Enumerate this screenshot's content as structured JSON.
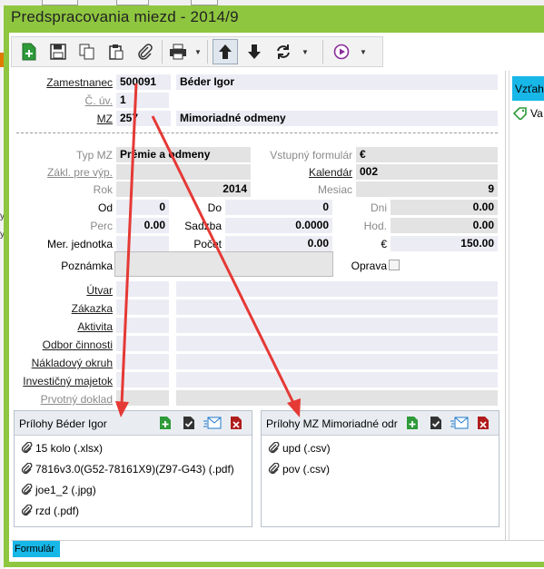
{
  "window": {
    "title": "Predspracovania miezd - 2014/9"
  },
  "background": {
    "left_fragments": [
      "y",
      "y"
    ]
  },
  "toolbar": {
    "icons": [
      "new-icon",
      "save-icon",
      "copy-icon",
      "paste-icon",
      "attach-icon",
      "print-icon",
      "arrow-up-icon",
      "arrow-down-icon",
      "refresh-icon",
      "play-icon"
    ]
  },
  "form": {
    "zamestnanec": {
      "label": "Zamestnanec",
      "code": "500091",
      "name": "Béder Igor"
    },
    "cuv": {
      "label": "Č. úv.",
      "value": "1"
    },
    "mz": {
      "label": "MZ",
      "code": "257",
      "name": "Mimoriadné odmeny"
    },
    "typ_mz": {
      "label": "Typ MZ",
      "value": "Prémie a odmeny"
    },
    "zakl_pre_vyp": {
      "label": "Zákl. pre výp.",
      "value": ""
    },
    "rok": {
      "label": "Rok",
      "value": "2014"
    },
    "od": {
      "label": "Od",
      "value": "0"
    },
    "perc": {
      "label": "Perc",
      "value": "0.00"
    },
    "mer_jednotka": {
      "label": "Mer. jednotka",
      "value": ""
    },
    "vstupny_formular": {
      "label": "Vstupný formulár",
      "value": "€"
    },
    "kalendar": {
      "label": "Kalendár",
      "value": "002"
    },
    "mesiac": {
      "label": "Mesiac",
      "value": "9"
    },
    "do": {
      "label": "Do",
      "value": "0"
    },
    "sadzba": {
      "label": "Sadzba",
      "value": "0.0000"
    },
    "pocet": {
      "label": "Počet",
      "value": "0.00"
    },
    "dni": {
      "label": "Dni",
      "value": "0.00"
    },
    "hod": {
      "label": "Hod.",
      "value": "0.00"
    },
    "eur": {
      "label": "€",
      "value": "150.00"
    },
    "poznamka": {
      "label": "Poznámka",
      "value": ""
    },
    "oprava": {
      "label": "Oprava",
      "checked": false
    },
    "utvar": {
      "label": "Útvar"
    },
    "zakazka": {
      "label": "Zákazka"
    },
    "aktivita": {
      "label": "Aktivita"
    },
    "odbor_cinnosti": {
      "label": "Odbor činnosti"
    },
    "nakladovy_okruh": {
      "label": "Nákladový okruh"
    },
    "investicny_majetok": {
      "label": "Investičný majetok"
    },
    "prvotny_doklad": {
      "label": "Prvotný doklad"
    }
  },
  "attachments_employee": {
    "title": "Prílohy Béder Igor",
    "files": [
      "15 kolo (.xlsx)",
      "7816v3.0(G52-78161X9)(Z97-G43) (.pdf)",
      "joe1_2 (.jpg)",
      "rzd (.pdf)"
    ]
  },
  "attachments_mz": {
    "title": "Prílohy MZ Mimoriadné odr",
    "files": [
      "upd (.csv)",
      "pov (.csv)"
    ]
  },
  "panel_icons": [
    "add-attachment-icon",
    "check-icon",
    "mail-icon",
    "delete-icon"
  ],
  "right_panel": {
    "tab": "Vzťah",
    "item": "Va"
  },
  "bottom": {
    "tab": "Formulár"
  },
  "colors": {
    "window_frame": "#8ec63f",
    "tab_accent": "#17b7e8",
    "annotation_arrow": "#e53935"
  }
}
